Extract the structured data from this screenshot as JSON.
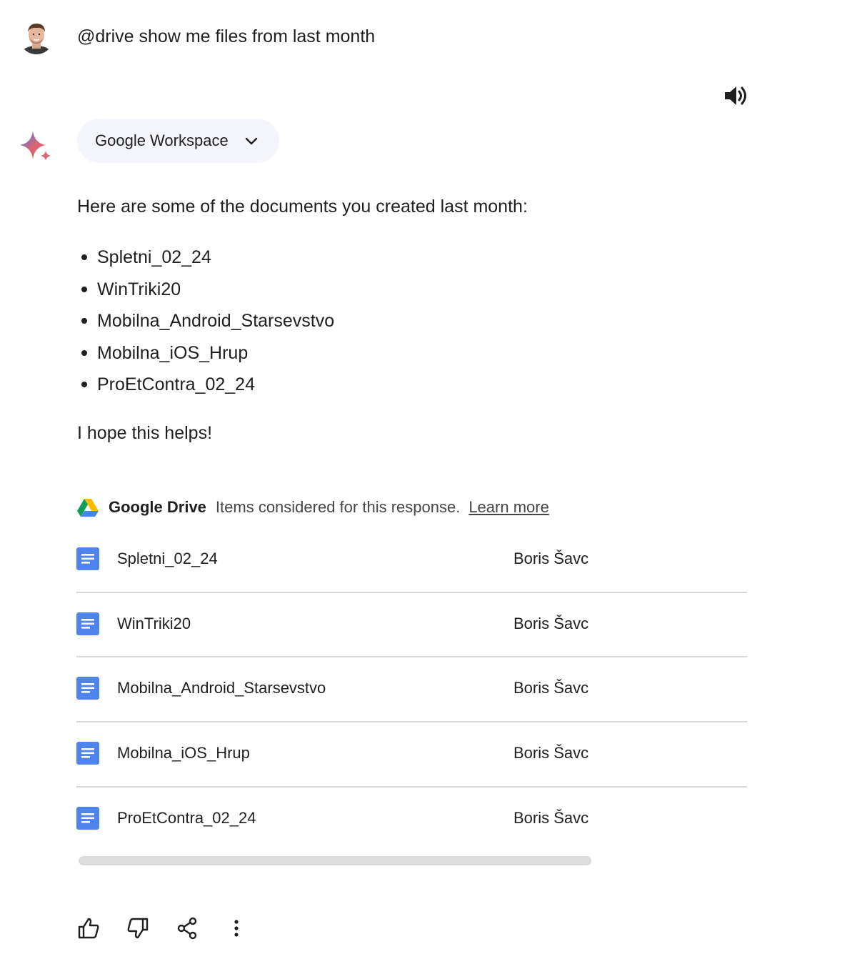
{
  "user_prompt": {
    "text": "@drive show me files from last month"
  },
  "response": {
    "extension_chip_label": "Google Workspace",
    "intro": "Here are some of the documents you created last month:",
    "bullets": [
      "Spletni_02_24",
      "WinTriki20",
      "Mobilna_Android_Starsevstvo",
      "Mobilna_iOS_Hrup",
      "ProEtContra_02_24"
    ],
    "outro": "I hope this helps!"
  },
  "sources": {
    "title": "Google Drive",
    "note": "Items considered for this response.",
    "learn_more": "Learn more",
    "files": [
      {
        "name": "Spletni_02_24",
        "owner": "Boris Šavc",
        "icon": "google-docs-icon"
      },
      {
        "name": "WinTriki20",
        "owner": "Boris Šavc",
        "icon": "google-docs-icon"
      },
      {
        "name": "Mobilna_Android_Starsevstvo",
        "owner": "Boris Šavc",
        "icon": "google-docs-icon"
      },
      {
        "name": "Mobilna_iOS_Hrup",
        "owner": "Boris Šavc",
        "icon": "google-docs-icon"
      },
      {
        "name": "ProEtContra_02_24",
        "owner": "Boris Šavc",
        "icon": "google-docs-icon"
      }
    ]
  },
  "icons": {
    "speaker": "speaker-icon",
    "sparkle": "gemini-sparkle-icon",
    "chevron": "chevron-down-icon",
    "drive": "google-drive-icon",
    "thumbs_up": "thumbs-up-icon",
    "thumbs_down": "thumbs-down-icon",
    "share": "share-icon",
    "more": "more-vert-icon"
  },
  "colors": {
    "doc_blue": "#4e84eb",
    "chip_bg": "#f4f6fb",
    "divider": "#d9d9d9",
    "sparkle_blue": "#4c7cf3",
    "sparkle_red": "#d96570"
  }
}
